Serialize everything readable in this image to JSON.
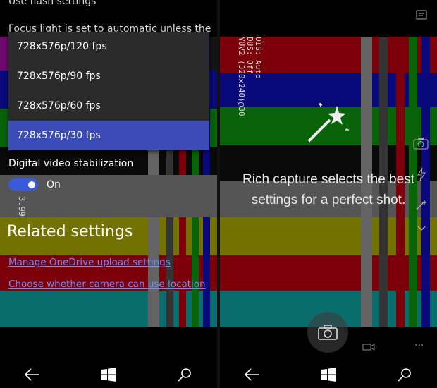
{
  "left": {
    "cut_title": "Use flash settings",
    "cut_caption": "Focus light is set to automatic unless the",
    "dropdown_options": [
      "728x576p/120 fps",
      "728x576p/90 fps",
      "728x576p/60 fps",
      "728x576p/30 fps"
    ],
    "selected_option": "728x576p/30 fps",
    "stabilization": {
      "label": "Digital video stabilization",
      "state": "On",
      "on": true
    },
    "related_title": "Related settings",
    "links": [
      "Manage OneDrive upload settings",
      "Choose whether camera can use location"
    ],
    "overlay_number": "3.99"
  },
  "right": {
    "overlay_text": "Rich capture selects the best settings for a perfect shot.",
    "osd_lines": [
      "OIS: Auto",
      "DUS: Off",
      "YUV2 (320x240)@30"
    ]
  },
  "nav": {
    "back_icon": "back-arrow-icon",
    "start_icon": "windows-logo-icon",
    "search_icon": "search-icon"
  },
  "colors": {
    "accent": "#3b4bb8",
    "toggle": "#3a5bd9",
    "link": "#6c8cff",
    "yellow": "#b8b800",
    "blue": "#1010c8",
    "green": "#10a010",
    "cyan": "#10b0b0",
    "red": "#c80010",
    "magenta": "#b010b0"
  }
}
